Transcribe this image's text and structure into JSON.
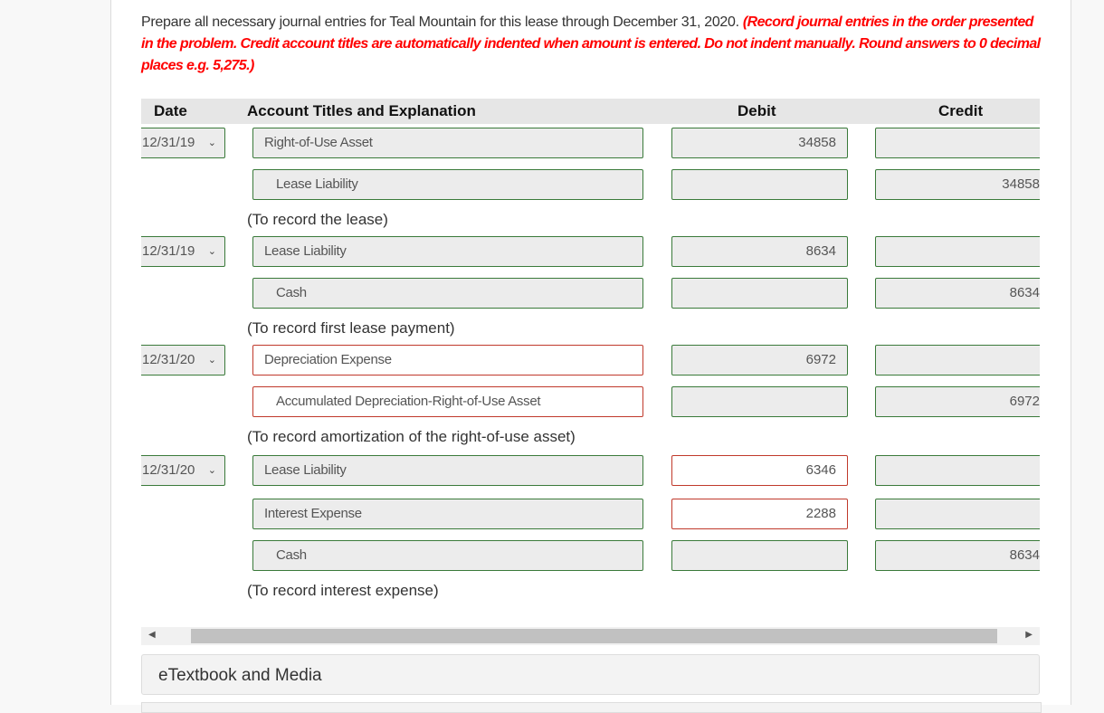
{
  "instructions": {
    "text": "Prepare all necessary journal entries for Teal Mountain for this lease through December 31, 2020. ",
    "emphasis": "(Record journal entries in the order presented in the problem. Credit account titles are automatically indented when amount is entered. Do not indent manually. Round answers to 0 decimal places e.g. 5,275.)"
  },
  "table": {
    "headers": {
      "date": "Date",
      "account": "Account Titles and Explanation",
      "debit": "Debit",
      "credit": "Credit"
    },
    "entries": [
      {
        "date": "12/31/19",
        "lines": [
          {
            "account": "Right-of-Use Asset",
            "debit": "34858",
            "credit": ""
          },
          {
            "account": "Lease Liability",
            "debit": "",
            "credit": "34858"
          }
        ],
        "memo": "(To record the lease)"
      },
      {
        "date": "12/31/19",
        "lines": [
          {
            "account": "Lease Liability",
            "debit": "8634",
            "credit": ""
          },
          {
            "account": "Cash",
            "debit": "",
            "credit": "8634"
          }
        ],
        "memo": "(To record first lease payment)"
      },
      {
        "date": "12/31/20",
        "lines": [
          {
            "account": "Depreciation Expense",
            "debit": "6972",
            "credit": ""
          },
          {
            "account": "Accumulated Depreciation-Right-of-Use Asset",
            "debit": "",
            "credit": "6972"
          }
        ],
        "memo": "(To record amortization of the right-of-use asset)"
      },
      {
        "date": "12/31/20",
        "lines": [
          {
            "account": "Lease Liability",
            "debit": "6346",
            "credit": ""
          },
          {
            "account": "Interest Expense",
            "debit": "2288",
            "credit": ""
          },
          {
            "account": "Cash",
            "debit": "",
            "credit": "8634"
          }
        ],
        "memo": "(To record interest expense)"
      }
    ]
  },
  "scrollbar": {
    "left_arrow": "◀",
    "right_arrow": "▶"
  },
  "etextbook": {
    "label": "eTextbook and Media"
  },
  "icons": {
    "chevron": "⌄"
  },
  "colors": {
    "correct_border": "#3a7a3a",
    "incorrect_border": "#c0392b",
    "instruction_emphasis": "#ff0000"
  }
}
